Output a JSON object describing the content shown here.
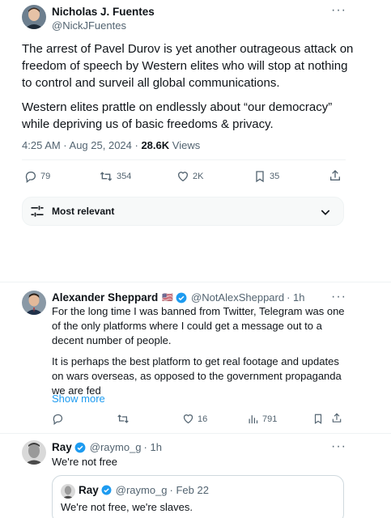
{
  "main_tweet": {
    "author_name": "Nicholas J. Fuentes",
    "author_handle": "@NickJFuentes",
    "paragraph1": "The arrest of Pavel Durov is yet another outrageous attack on freedom of speech by Western elites who will stop at nothing to control and surveil all global communications.",
    "paragraph2": "Western elites prattle on endlessly about “our democracy” while depriving us of basic freedoms & privacy.",
    "timestamp": "4:25 AM · Aug 25, 2024 ·",
    "views_count": "28.6K",
    "views_label": "Views",
    "replies": "79",
    "reposts": "354",
    "likes": "2K",
    "bookmarks": "35"
  },
  "sort": {
    "label": "Most relevant"
  },
  "reply1": {
    "author_name": "Alexander Sheppard",
    "flag": "🇺🇸",
    "author_handle": "@NotAlexSheppard",
    "time": "· 1h",
    "paragraph1": "For the long time I was banned from Twitter, Telegram was one of the only platforms where I could get a message out to a decent number of people.",
    "paragraph2": "It is perhaps the best platform to get real footage and updates on wars overseas, as opposed to the government propaganda we are fed",
    "show_more": "Show more",
    "likes": "16",
    "views": "791"
  },
  "reply2": {
    "author_name": "Ray",
    "author_handle": "@raymo_g",
    "time": "· 1h",
    "text": "We're not free",
    "quote": {
      "author_name": "Ray",
      "author_handle": "@raymo_g",
      "time": "· Feb 22",
      "text": "We're not free, we're slaves."
    }
  },
  "colors": {
    "verified": "#1d9bf0",
    "link": "#1d9bf0",
    "muted": "#536471"
  }
}
